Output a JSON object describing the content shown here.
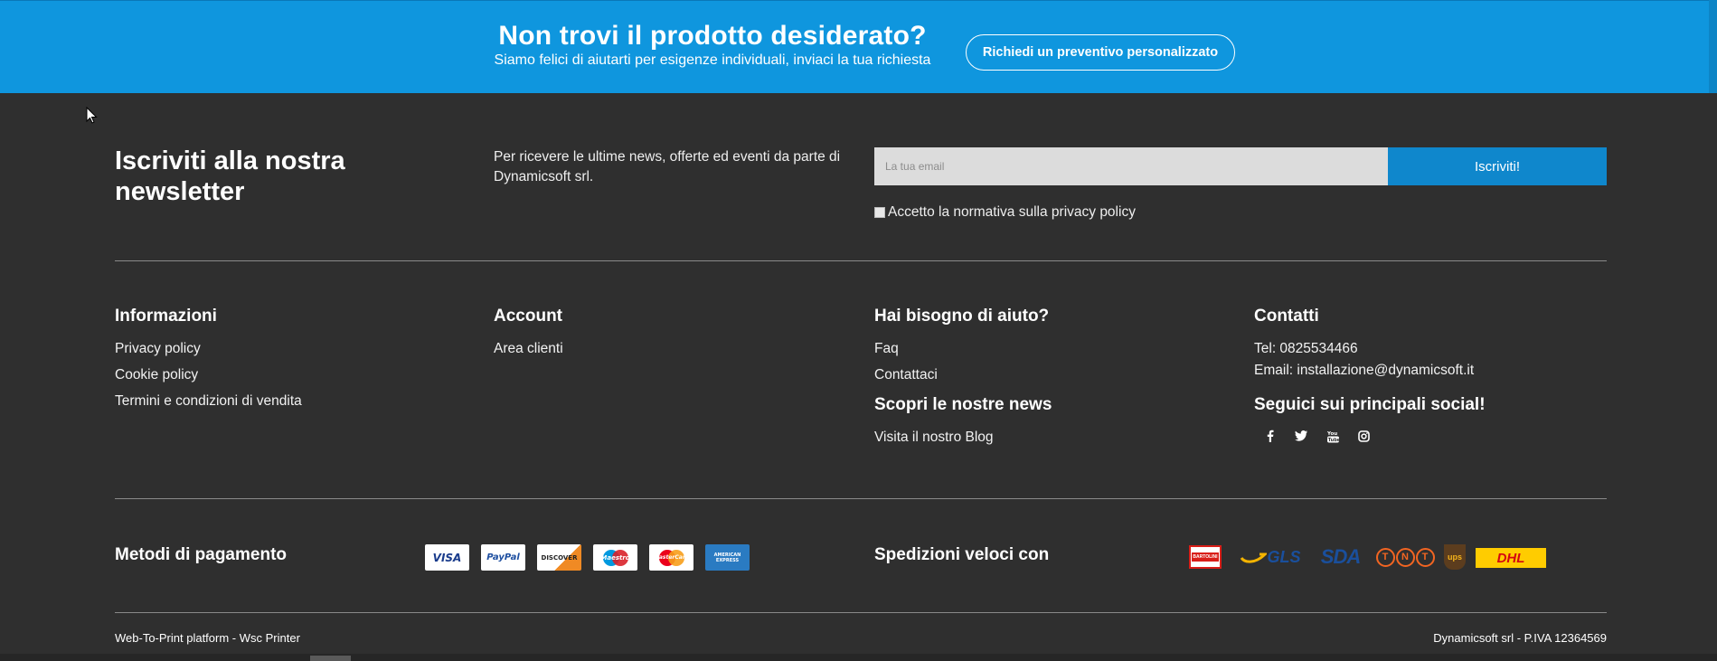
{
  "banner": {
    "title": "Non trovi il prodotto desiderato?",
    "subtitle": "Siamo felici di aiutarti per esigenze individuali, inviaci la tua richiesta",
    "button": "Richiedi un preventivo personalizzato",
    "bg_color": "#0f96de"
  },
  "newsletter": {
    "title": "Iscriviti alla nostra newsletter",
    "description": "Per ricevere le ultime news, offerte ed eventi da parte di Dynamicsoft srl.",
    "email_placeholder": "La tua email",
    "email_value": "",
    "submit": "Iscriviti!",
    "privacy": "Accetto la normativa sulla privacy policy",
    "privacy_checked": false
  },
  "footer": {
    "informazioni": {
      "heading": "Informazioni",
      "links": [
        "Privacy policy",
        "Cookie policy",
        "Termini e condizioni di vendita"
      ]
    },
    "account": {
      "heading": "Account",
      "links": [
        "Area clienti"
      ]
    },
    "aiuto": {
      "heading": "Hai bisogno di aiuto?",
      "links": [
        "Faq",
        "Contattaci"
      ]
    },
    "news": {
      "heading": "Scopri le nostre news",
      "links": [
        "Visita il nostro Blog"
      ]
    },
    "contatti": {
      "heading": "Contatti",
      "tel": "Tel: 0825534466",
      "email": "Email: installazione@dynamicsoft.it"
    },
    "social": {
      "heading": "Seguici sui principali social!",
      "icons": [
        "facebook-icon",
        "twitter-icon",
        "youtube-icon",
        "instagram-icon"
      ]
    }
  },
  "payment": {
    "heading": "Metodi di pagamento",
    "cards": [
      {
        "label": "VISA",
        "color": "#1a3c8c"
      },
      {
        "label": "PayPal",
        "color": "#1e4fa0"
      },
      {
        "label": "DISCOVER",
        "color": "#222222"
      },
      {
        "label": "Maestro",
        "color": "#cc0000"
      },
      {
        "label": "MasterCard",
        "color": "#ee6f1d"
      },
      {
        "label": "AMERICAN EXPRESS",
        "color": "#2a7bc2"
      }
    ]
  },
  "shipping": {
    "heading": "Spedizioni veloci con",
    "carriers": [
      {
        "label": "BARTOLINI",
        "color": "#d91e18"
      },
      {
        "label": "GLS",
        "color": "#f4b400"
      },
      {
        "label": "SDA",
        "color": "#1a4f9c"
      },
      {
        "label": "TNT",
        "color": "#f26522"
      },
      {
        "label": "ups",
        "color": "#5c3d1e"
      },
      {
        "label": "DHL",
        "color": "#ffcc00"
      }
    ]
  },
  "bottom": {
    "left": "Web-To-Print platform - Wsc Printer",
    "right": "Dynamicsoft srl - P.IVA 12364569"
  }
}
